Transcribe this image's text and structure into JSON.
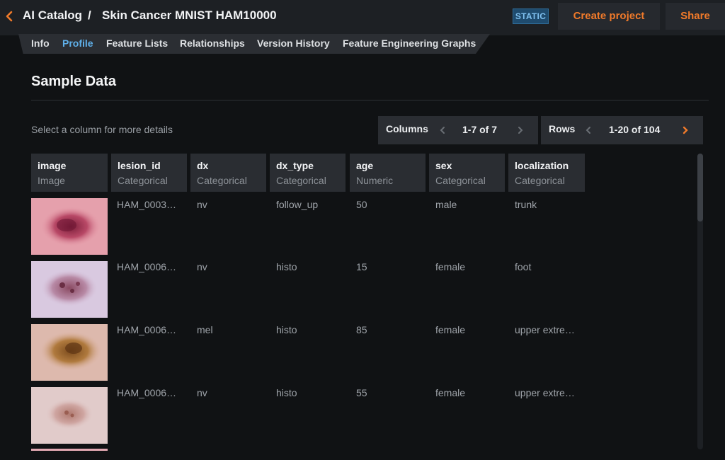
{
  "header": {
    "back_icon": "chevron-left-icon",
    "root": "AI Catalog",
    "separator": "/",
    "title": "Skin Cancer MNIST HAM10000",
    "badge": "STATIC",
    "create_project": "Create project",
    "share": "Share",
    "accent": "#f07a2a"
  },
  "tabs": [
    {
      "label": "Info",
      "active": false
    },
    {
      "label": "Profile",
      "active": true
    },
    {
      "label": "Feature Lists",
      "active": false
    },
    {
      "label": "Relationships",
      "active": false
    },
    {
      "label": "Version History",
      "active": false
    },
    {
      "label": "Feature Engineering Graphs",
      "active": false
    }
  ],
  "section": {
    "title": "Sample Data",
    "hint": "Select a column for more details"
  },
  "columns_pager": {
    "label": "Columns",
    "range": "1-7 of 7"
  },
  "rows_pager": {
    "label": "Rows",
    "range": "1-20 of 104"
  },
  "columns": [
    {
      "name": "image",
      "type": "Image"
    },
    {
      "name": "lesion_id",
      "type": "Categorical"
    },
    {
      "name": "dx",
      "type": "Categorical"
    },
    {
      "name": "dx_type",
      "type": "Categorical"
    },
    {
      "name": "age",
      "type": "Numeric"
    },
    {
      "name": "sex",
      "type": "Categorical"
    },
    {
      "name": "localization",
      "type": "Categorical"
    }
  ],
  "rows": [
    {
      "lesion_id": "HAM_0003…",
      "dx": "nv",
      "dx_type": "follow_up",
      "age": "50",
      "sex": "male",
      "localization": "trunk"
    },
    {
      "lesion_id": "HAM_0006…",
      "dx": "nv",
      "dx_type": "histo",
      "age": "15",
      "sex": "female",
      "localization": "foot"
    },
    {
      "lesion_id": "HAM_0006…",
      "dx": "mel",
      "dx_type": "histo",
      "age": "85",
      "sex": "female",
      "localization": "upper extre…"
    },
    {
      "lesion_id": "HAM_0006…",
      "dx": "nv",
      "dx_type": "histo",
      "age": "55",
      "sex": "female",
      "localization": "upper extre…"
    }
  ]
}
